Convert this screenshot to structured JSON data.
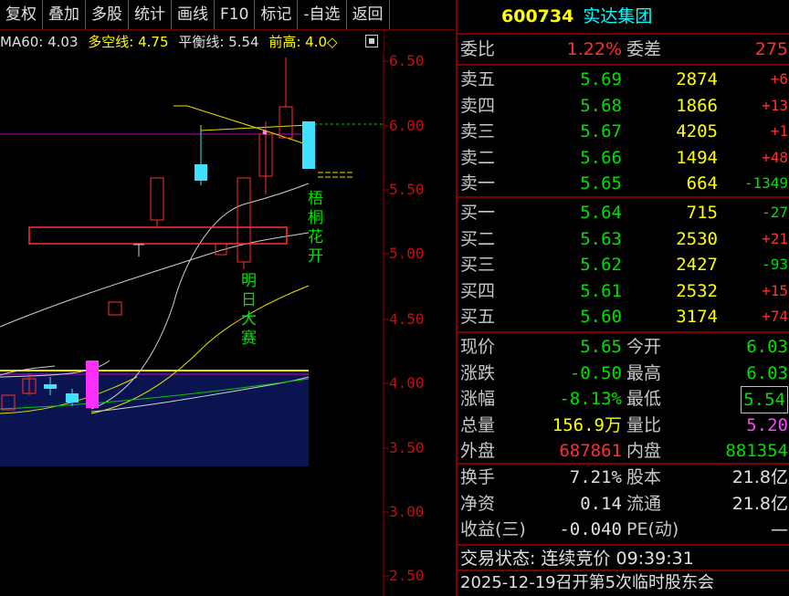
{
  "toolbar": [
    "复权",
    "叠加",
    "多股",
    "统计",
    "画线",
    "F10",
    "标记",
    "-自选",
    "返回"
  ],
  "ma_bar": {
    "ma60": "MA60: 4.03",
    "dkx": "多空线: 4.75",
    "balance": "平衡线: 5.54",
    "prev_high": "前高: 4.0◇"
  },
  "y_axis": [
    "6.50",
    "6.00",
    "5.50",
    "5.00",
    "4.50",
    "4.00",
    "3.50",
    "3.00",
    "2.50"
  ],
  "annotations": {
    "wutong": "梧桐花开",
    "mingri": "明日大赛"
  },
  "stock": {
    "code": "600734",
    "name": "实达集团"
  },
  "weibi": {
    "label": "委比",
    "value": "1.22%",
    "diff_label": "委差",
    "diff_value": "275"
  },
  "asks": [
    {
      "label": "卖五",
      "price": "5.69",
      "vol": "2874",
      "chg": "+6"
    },
    {
      "label": "卖四",
      "price": "5.68",
      "vol": "1866",
      "chg": "+13"
    },
    {
      "label": "卖三",
      "price": "5.67",
      "vol": "4205",
      "chg": "+1"
    },
    {
      "label": "卖二",
      "price": "5.66",
      "vol": "1494",
      "chg": "+48"
    },
    {
      "label": "卖一",
      "price": "5.65",
      "vol": "664",
      "chg": "-1349"
    }
  ],
  "bids": [
    {
      "label": "买一",
      "price": "5.64",
      "vol": "715",
      "chg": "-27"
    },
    {
      "label": "买二",
      "price": "5.63",
      "vol": "2530",
      "chg": "+21"
    },
    {
      "label": "买三",
      "price": "5.62",
      "vol": "2427",
      "chg": "-93"
    },
    {
      "label": "买四",
      "price": "5.61",
      "vol": "2532",
      "chg": "+15"
    },
    {
      "label": "买五",
      "price": "5.60",
      "vol": "3174",
      "chg": "+74"
    }
  ],
  "quote": [
    {
      "l1": "现价",
      "v1": "5.65",
      "l2": "今开",
      "v2": "6.03"
    },
    {
      "l1": "涨跌",
      "v1": "-0.50",
      "l2": "最高",
      "v2": "6.03"
    },
    {
      "l1": "涨幅",
      "v1": "-8.13%",
      "l2": "最低",
      "v2": "5.54"
    },
    {
      "l1": "总量",
      "v1": "156.9万",
      "l2": "量比",
      "v2": "5.20"
    },
    {
      "l1": "外盘",
      "v1": "687861",
      "l2": "内盘",
      "v2": "881354"
    }
  ],
  "fund": [
    {
      "l1": "换手",
      "v1": "7.21%",
      "l2": "股本",
      "v2": "21.8亿"
    },
    {
      "l1": "净资",
      "v1": "0.14",
      "l2": "流通",
      "v2": "21.8亿"
    },
    {
      "l1": "收益(三)",
      "v1": "-0.040",
      "l2": "PE(动)",
      "v2": "—"
    }
  ],
  "status": "交易状态: 连续竞价 09:39:31",
  "notice": "2025-12-19召开第5次临时股东会",
  "colors": {
    "up": "#ff3030",
    "down": "#00e000",
    "border": "#7a0000"
  }
}
